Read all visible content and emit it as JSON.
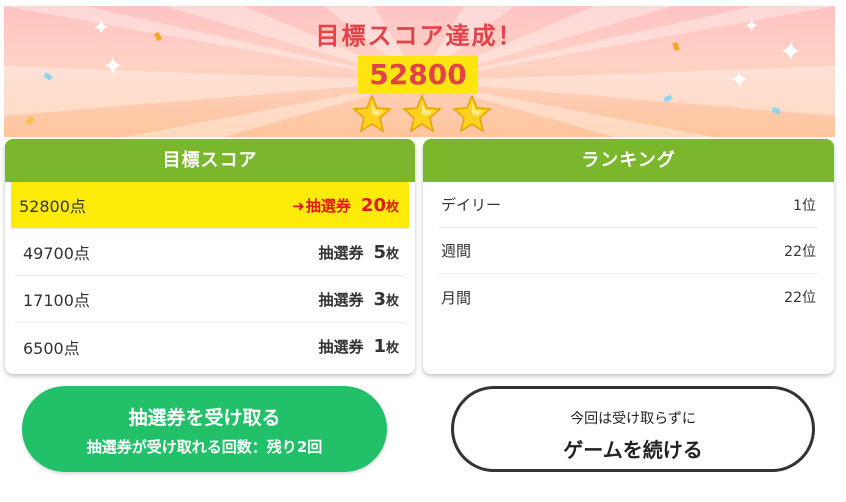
{
  "banner": {
    "title": "目標スコア達成！",
    "score": "52800",
    "stars_filled": 3,
    "stars_total": 3
  },
  "target_score": {
    "header": "目標スコア",
    "rows": [
      {
        "points": "52800点",
        "ticket_label": "抽選券",
        "count": "20",
        "unit": "枚",
        "highlighted": true
      },
      {
        "points": "49700点",
        "ticket_label": "抽選券",
        "count": "5",
        "unit": "枚",
        "highlighted": false
      },
      {
        "points": "17100点",
        "ticket_label": "抽選券",
        "count": "3",
        "unit": "枚",
        "highlighted": false
      },
      {
        "points": "6500点",
        "ticket_label": "抽選券",
        "count": "1",
        "unit": "枚",
        "highlighted": false
      }
    ]
  },
  "ranking": {
    "header": "ランキング",
    "rows": [
      {
        "label": "デイリー",
        "value": "1位"
      },
      {
        "label": "週間",
        "value": "22位"
      },
      {
        "label": "月間",
        "value": "22位"
      }
    ]
  },
  "buttons": {
    "receive": {
      "line1": "抽選券を受け取る",
      "line2": "抽選券が受け取れる回数：残り2回"
    },
    "continue": {
      "line1": "今回は受け取らずに",
      "line2": "ゲームを続ける"
    }
  },
  "colors": {
    "accent_green": "#7ab72c",
    "button_green": "#22c068",
    "highlight_yellow": "#ffeb0a",
    "title_red": "#e2434a"
  },
  "icons": [
    "star-icon",
    "sparkle-icon",
    "arrow-right-icon"
  ]
}
